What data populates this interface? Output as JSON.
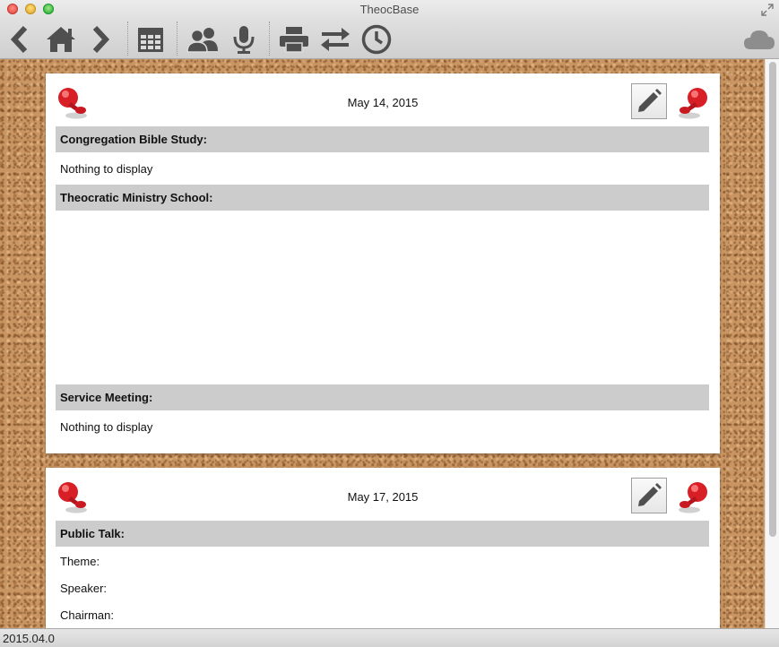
{
  "window": {
    "title": "TheocBase"
  },
  "toolbar": {
    "buttons": [
      {
        "icon": "chevron-left-icon"
      },
      {
        "icon": "home-icon"
      },
      {
        "icon": "chevron-right-icon"
      },
      {
        "icon": "calendar-grid-icon"
      },
      {
        "icon": "people-icon"
      },
      {
        "icon": "microphone-icon"
      },
      {
        "icon": "printer-icon"
      },
      {
        "icon": "transfer-arrows-icon"
      },
      {
        "icon": "clock-icon"
      },
      {
        "icon": "cloud-icon"
      }
    ],
    "icon_color": "#4f4f4f"
  },
  "meetings": [
    {
      "date": "May 14, 2015",
      "sections": [
        {
          "title": "Congregation Bible Study:",
          "rows": [
            "Nothing to display"
          ]
        },
        {
          "title": "Theocratic Ministry School:",
          "rows": []
        },
        {
          "title": "Service Meeting:",
          "rows": [
            "Nothing to display"
          ]
        }
      ]
    },
    {
      "date": "May 17, 2015",
      "sections": [
        {
          "title": "Public Talk:",
          "rows": [
            "Theme:",
            "Speaker:",
            "Chairman:"
          ]
        }
      ]
    }
  ],
  "status": {
    "version": "2015.04.0"
  },
  "colors": {
    "section_header_bg": "#cccccc",
    "cork": "#c99562",
    "pin_red": "#d81f26"
  }
}
